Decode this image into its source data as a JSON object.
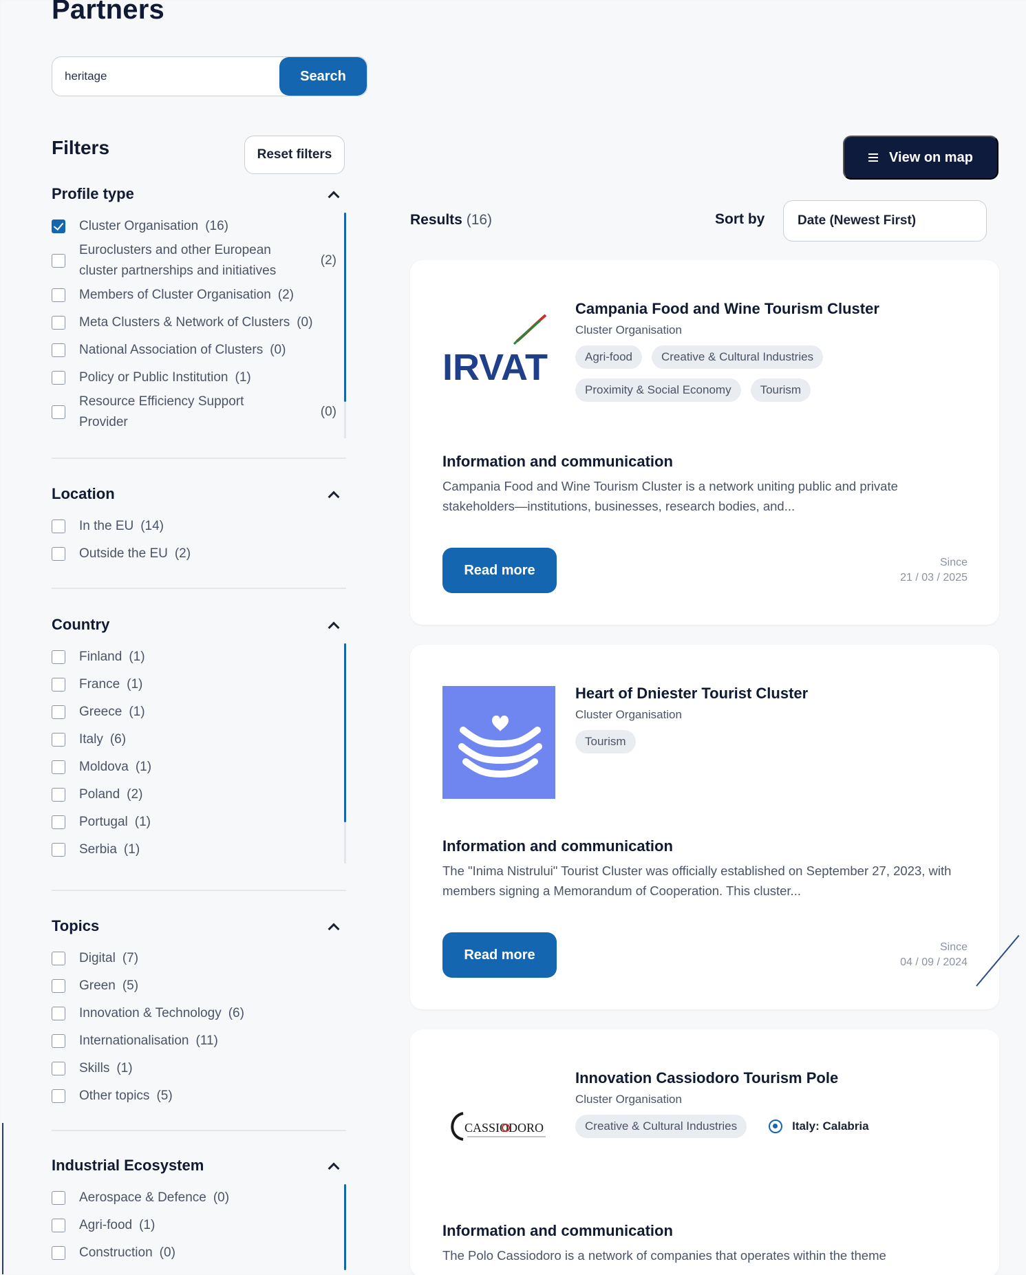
{
  "page": {
    "title": "Partners"
  },
  "search": {
    "value": "heritage",
    "button_label": "Search"
  },
  "filters": {
    "title": "Filters",
    "reset_label": "Reset filters",
    "profile_type": {
      "title": "Profile type",
      "items": [
        {
          "label": "Cluster Organisation",
          "count": "(16)",
          "checked": true
        },
        {
          "label": "Euroclusters and other European cluster partnerships and initiatives",
          "count": "(2)",
          "checked": false
        },
        {
          "label": "Members of Cluster Organisation",
          "count": "(2)",
          "checked": false
        },
        {
          "label": "Meta Clusters & Network of Clusters",
          "count": "(0)",
          "checked": false
        },
        {
          "label": "National Association of Clusters",
          "count": "(0)",
          "checked": false
        },
        {
          "label": "Policy or Public Institution",
          "count": "(1)",
          "checked": false
        },
        {
          "label": "Resource Efficiency Support Provider",
          "count": "(0)",
          "checked": false
        }
      ]
    },
    "location": {
      "title": "Location",
      "items": [
        {
          "label": "In the EU",
          "count": "(14)"
        },
        {
          "label": "Outside the EU",
          "count": "(2)"
        }
      ]
    },
    "country": {
      "title": "Country",
      "items": [
        {
          "label": "Finland",
          "count": "(1)"
        },
        {
          "label": "France",
          "count": "(1)"
        },
        {
          "label": "Greece",
          "count": "(1)"
        },
        {
          "label": "Italy",
          "count": "(6)"
        },
        {
          "label": "Moldova",
          "count": "(1)"
        },
        {
          "label": "Poland",
          "count": "(2)"
        },
        {
          "label": "Portugal",
          "count": "(1)"
        },
        {
          "label": "Serbia",
          "count": "(1)"
        }
      ]
    },
    "topics": {
      "title": "Topics",
      "items": [
        {
          "label": "Digital",
          "count": "(7)"
        },
        {
          "label": "Green",
          "count": "(5)"
        },
        {
          "label": "Innovation & Technology",
          "count": "(6)"
        },
        {
          "label": "Internationalisation",
          "count": "(11)"
        },
        {
          "label": "Skills",
          "count": "(1)"
        },
        {
          "label": "Other topics",
          "count": "(5)"
        }
      ]
    },
    "industrial_ecosystem": {
      "title": "Industrial Ecosystem",
      "items": [
        {
          "label": "Aerospace & Defence",
          "count": "(0)"
        },
        {
          "label": "Agri-food",
          "count": "(1)"
        },
        {
          "label": "Construction",
          "count": "(0)"
        }
      ]
    }
  },
  "toolbar": {
    "map_button_label": "View on map",
    "results_label": "Results",
    "results_count": "(16)",
    "sort_label": "Sort by",
    "sort_value": "Date (Newest First)"
  },
  "cards": [
    {
      "title": "Campania Food and Wine Tourism Cluster",
      "type": "Cluster Organisation",
      "logo_text": "IRVAT",
      "tags": [
        "Agri-food",
        "Creative & Cultural Industries",
        "Proximity & Social Economy",
        "Tourism"
      ],
      "section": "Information and communication",
      "description": "Campania Food and Wine Tourism Cluster is a network uniting public and private stakeholders—institutions, businesses, research bodies, and...",
      "read_more": "Read more",
      "since_label": "Since",
      "since_date": "21 / 03 / 2025"
    },
    {
      "title": "Heart of Dniester Tourist Cluster",
      "type": "Cluster Organisation",
      "tags": [
        "Tourism"
      ],
      "section": "Information and communication",
      "description": "The \"Inima Nistrului\" Tourist Cluster was officially established on September 27, 2023, with members signing a Memorandum of Cooperation. This cluster...",
      "read_more": "Read more",
      "since_label": "Since",
      "since_date": "04 / 09 / 2024"
    },
    {
      "title": "Innovation Cassiodoro Tourism Pole",
      "type": "Cluster Organisation",
      "logo_text": "CASSIODORO",
      "tags": [
        "Creative & Cultural Industries"
      ],
      "location": "Italy: Calabria",
      "section": "Information and communication",
      "description": "The Polo Cassiodoro is a network of companies that operates within the theme"
    }
  ],
  "colors": {
    "primary": "#1466b0",
    "navy": "#0e1b3d",
    "tag_bg": "#e9ecf1",
    "irvat_blue": "#1f3f8a",
    "irvat_green": "#1f8a3a",
    "irvat_red": "#c8302c",
    "dniester_bg": "#6f86f0"
  }
}
